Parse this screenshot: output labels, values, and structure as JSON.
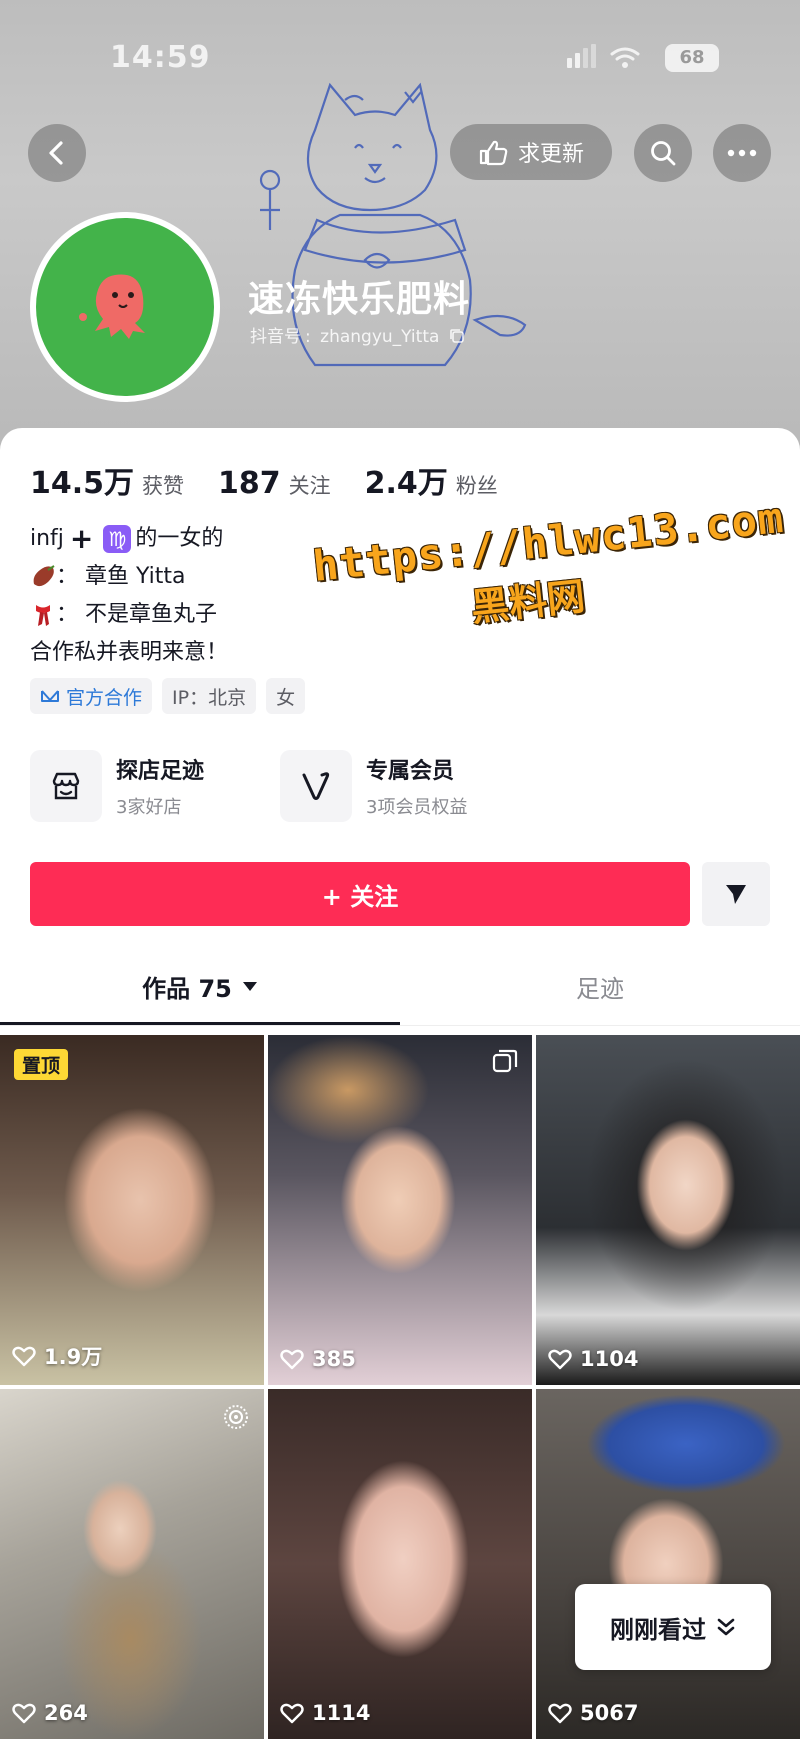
{
  "status_bar": {
    "time": "14:59",
    "battery": "68"
  },
  "header": {
    "request_update_label": "求更新"
  },
  "profile": {
    "nickname": "速冻快乐肥料",
    "douyin_id_label": "抖音号",
    "douyin_id": "zhangyu_Yitta",
    "avatar_color": "#43b34a"
  },
  "stats": [
    {
      "value": "14.5万",
      "label": "获赞"
    },
    {
      "value": "187",
      "label": "关注"
    },
    {
      "value": "2.4万",
      "label": "粉丝"
    }
  ],
  "bio": {
    "line1_prefix": "infj",
    "line1_sign": "♍",
    "line1_suffix": "的一女的",
    "line2": "： 章鱼 Yitta",
    "line3": "： 不是章鱼丸子",
    "line4": "合作私并表明来意！"
  },
  "tags": {
    "official": "官方合作",
    "ip": "IP：北京",
    "gender": "女"
  },
  "services": [
    {
      "title": "探店足迹",
      "subtitle": "3家好店",
      "icon": "shop-icon"
    },
    {
      "title": "专属会员",
      "subtitle": "3项会员权益",
      "icon": "vip-v-icon"
    }
  ],
  "actions": {
    "follow_label": "+ 关注"
  },
  "tabs": {
    "works_label": "作品 75",
    "footprint_label": "足迹"
  },
  "videos": [
    {
      "likes": "1.9万",
      "pinned": true,
      "pin_label": "置顶"
    },
    {
      "likes": "385"
    },
    {
      "likes": "1104"
    },
    {
      "likes": "264"
    },
    {
      "likes": "1114"
    },
    {
      "likes": "5067"
    }
  ],
  "just_seen": {
    "label": "刚刚看过"
  },
  "watermark": {
    "url": "https://hlwc13.com",
    "name": "黑料网"
  },
  "colors": {
    "accent": "#fe2c55",
    "pin_badge": "#fdd835",
    "watermark": "#f8a51c"
  }
}
